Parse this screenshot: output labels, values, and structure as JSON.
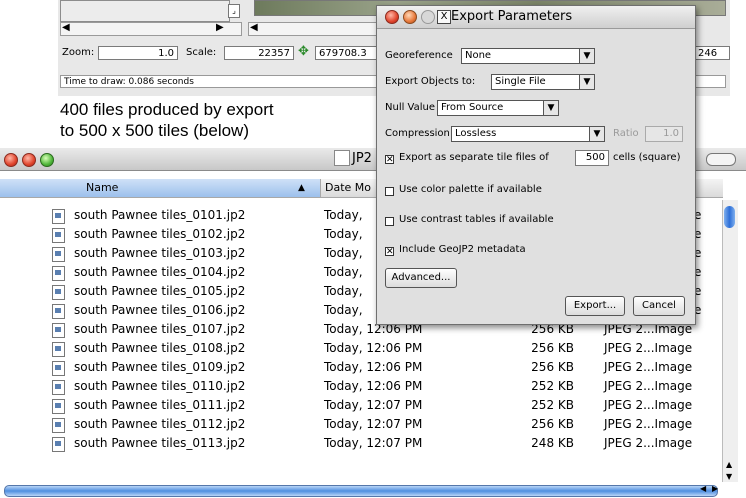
{
  "top_window": {
    "zoom_label": "Zoom:",
    "zoom_value": "1.0",
    "scale_label": "Scale:",
    "scale_value": "22357",
    "coord_value": "679708.3",
    "right_value": "246",
    "status": "Time to draw: 0.086 seconds"
  },
  "caption": {
    "line1": "400 files produced by export",
    "line2": "to 500 x 500 tiles (below)"
  },
  "finder": {
    "title": "JP2",
    "columns": {
      "name": "Name",
      "date": "Date Mo"
    },
    "visible_kind_fragment": "e",
    "rows": [
      {
        "name": "south Pawnee tiles_0101.jp2",
        "date": "Today,",
        "size": "",
        "kind": "e"
      },
      {
        "name": "south Pawnee tiles_0102.jp2",
        "date": "Today,",
        "size": "",
        "kind": "e"
      },
      {
        "name": "south Pawnee tiles_0103.jp2",
        "date": "Today,",
        "size": "",
        "kind": "e"
      },
      {
        "name": "south Pawnee tiles_0104.jp2",
        "date": "Today,",
        "size": "",
        "kind": "e"
      },
      {
        "name": "south Pawnee tiles_0105.jp2",
        "date": "Today,",
        "size": "",
        "kind": "e"
      },
      {
        "name": "south Pawnee tiles_0106.jp2",
        "date": "Today,",
        "size": "",
        "kind": "e"
      },
      {
        "name": "south Pawnee tiles_0107.jp2",
        "date": "Today, 12:06 PM",
        "size": "256 KB",
        "kind": "JPEG 2...Image"
      },
      {
        "name": "south Pawnee tiles_0108.jp2",
        "date": "Today, 12:06 PM",
        "size": "256 KB",
        "kind": "JPEG 2...Image"
      },
      {
        "name": "south Pawnee tiles_0109.jp2",
        "date": "Today, 12:06 PM",
        "size": "256 KB",
        "kind": "JPEG 2...Image"
      },
      {
        "name": "south Pawnee tiles_0110.jp2",
        "date": "Today, 12:06 PM",
        "size": "252 KB",
        "kind": "JPEG 2...Image"
      },
      {
        "name": "south Pawnee tiles_0111.jp2",
        "date": "Today, 12:07 PM",
        "size": "252 KB",
        "kind": "JPEG 2...Image"
      },
      {
        "name": "south Pawnee tiles_0112.jp2",
        "date": "Today, 12:07 PM",
        "size": "256 KB",
        "kind": "JPEG 2...Image"
      },
      {
        "name": "south Pawnee tiles_0113.jp2",
        "date": "Today, 12:07 PM",
        "size": "248 KB",
        "kind": "JPEG 2...Image"
      }
    ]
  },
  "dialog": {
    "title": "Export Parameters",
    "close_glyph": "X",
    "georeference_label": "Georeference",
    "georeference_value": "None",
    "export_objects_label": "Export Objects to:",
    "export_objects_value": "Single File",
    "null_value_label": "Null Value",
    "null_value_value": "From Source",
    "compression_label": "Compression",
    "compression_value": "Lossless",
    "ratio_label": "Ratio",
    "ratio_value": "1.0",
    "separate_tiles_label": "Export as separate tile files of",
    "separate_tiles_cells": "500",
    "separate_tiles_suffix": "cells (square)",
    "separate_tiles_checked": true,
    "color_palette_label": "Use color palette if available",
    "color_palette_checked": false,
    "contrast_label": "Use contrast tables if available",
    "contrast_checked": false,
    "geojp2_label": "Include GeoJP2 metadata",
    "geojp2_checked": true,
    "advanced_button": "Advanced...",
    "export_button": "Export...",
    "cancel_button": "Cancel"
  }
}
